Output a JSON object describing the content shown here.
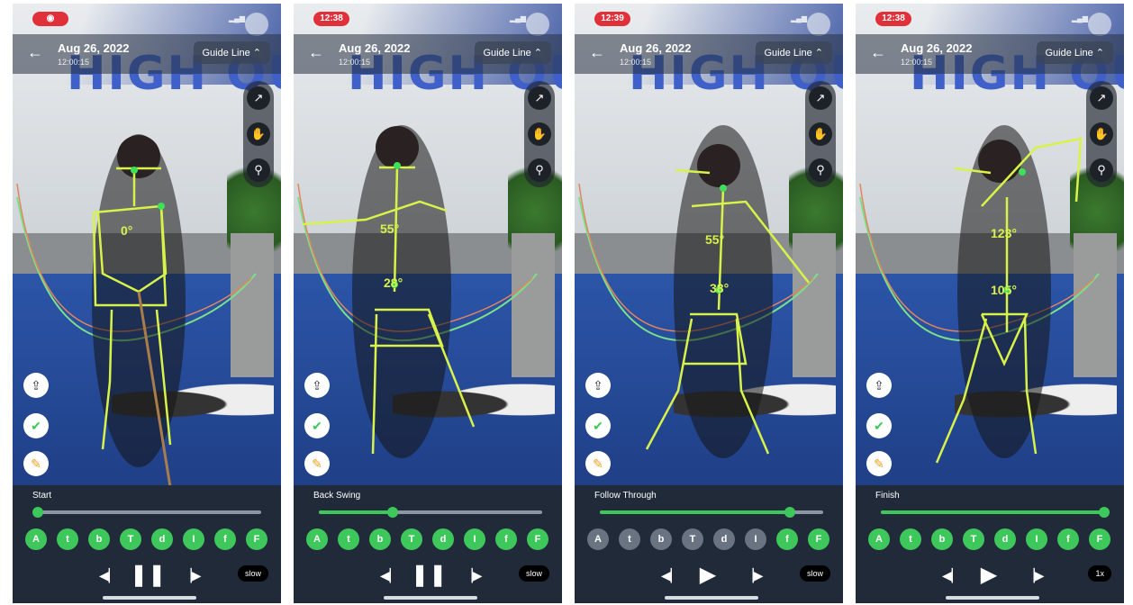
{
  "colors": {
    "skeleton": "#d9f24a",
    "joint": "#3ee05a",
    "arc_green": "#7be08a",
    "arc_orange": "#e2855f",
    "accent": "#3ec75a",
    "record": "#e0303a"
  },
  "screens": [
    {
      "status_time": "",
      "date": "Aug 26, 2022",
      "time": "12:00:15",
      "guide_label": "Guide Line",
      "banner": "HIGH QU",
      "phase": "Start",
      "progress": 0.0,
      "angles": {
        "upper": "0°",
        "lower": ""
      },
      "chips": [
        {
          "l": "A",
          "on": true
        },
        {
          "l": "t",
          "on": true
        },
        {
          "l": "b",
          "on": true
        },
        {
          "l": "T",
          "on": true
        },
        {
          "l": "d",
          "on": true
        },
        {
          "l": "I",
          "on": true
        },
        {
          "l": "f",
          "on": true
        },
        {
          "l": "F",
          "on": true
        }
      ],
      "playback": "pause",
      "speed": "slow"
    },
    {
      "status_time": "12:38",
      "date": "Aug 26, 2022",
      "time": "12:00:15",
      "guide_label": "Guide Line",
      "banner": "HIGH QU",
      "phase": "Back Swing",
      "progress": 0.33,
      "angles": {
        "upper": "55°",
        "lower": "28°"
      },
      "chips": [
        {
          "l": "A",
          "on": true
        },
        {
          "l": "t",
          "on": true
        },
        {
          "l": "b",
          "on": true
        },
        {
          "l": "T",
          "on": true
        },
        {
          "l": "d",
          "on": true
        },
        {
          "l": "I",
          "on": true
        },
        {
          "l": "f",
          "on": true
        },
        {
          "l": "F",
          "on": true
        }
      ],
      "playback": "pause",
      "speed": "slow"
    },
    {
      "status_time": "12:39",
      "date": "Aug 26, 2022",
      "time": "12:00:15",
      "guide_label": "Guide Line",
      "banner": "HIGH QU",
      "phase": "Follow Through",
      "progress": 0.85,
      "angles": {
        "upper": "55°",
        "lower": "38°"
      },
      "chips": [
        {
          "l": "A",
          "on": false
        },
        {
          "l": "t",
          "on": false
        },
        {
          "l": "b",
          "on": false
        },
        {
          "l": "T",
          "on": false
        },
        {
          "l": "d",
          "on": false
        },
        {
          "l": "I",
          "on": false
        },
        {
          "l": "f",
          "on": true
        },
        {
          "l": "F",
          "on": true
        }
      ],
      "playback": "play",
      "speed": "slow"
    },
    {
      "status_time": "12:38",
      "date": "Aug 26, 2022",
      "time": "12:00:15",
      "guide_label": "Guide Line",
      "banner": "HIGH QU",
      "phase": "Finish",
      "progress": 1.0,
      "angles": {
        "upper": "123°",
        "lower": "105°"
      },
      "chips": [
        {
          "l": "A",
          "on": true
        },
        {
          "l": "t",
          "on": true
        },
        {
          "l": "b",
          "on": true
        },
        {
          "l": "T",
          "on": true
        },
        {
          "l": "d",
          "on": true
        },
        {
          "l": "I",
          "on": true
        },
        {
          "l": "f",
          "on": true
        },
        {
          "l": "F",
          "on": true
        }
      ],
      "playback": "play",
      "speed": "1x"
    }
  ]
}
